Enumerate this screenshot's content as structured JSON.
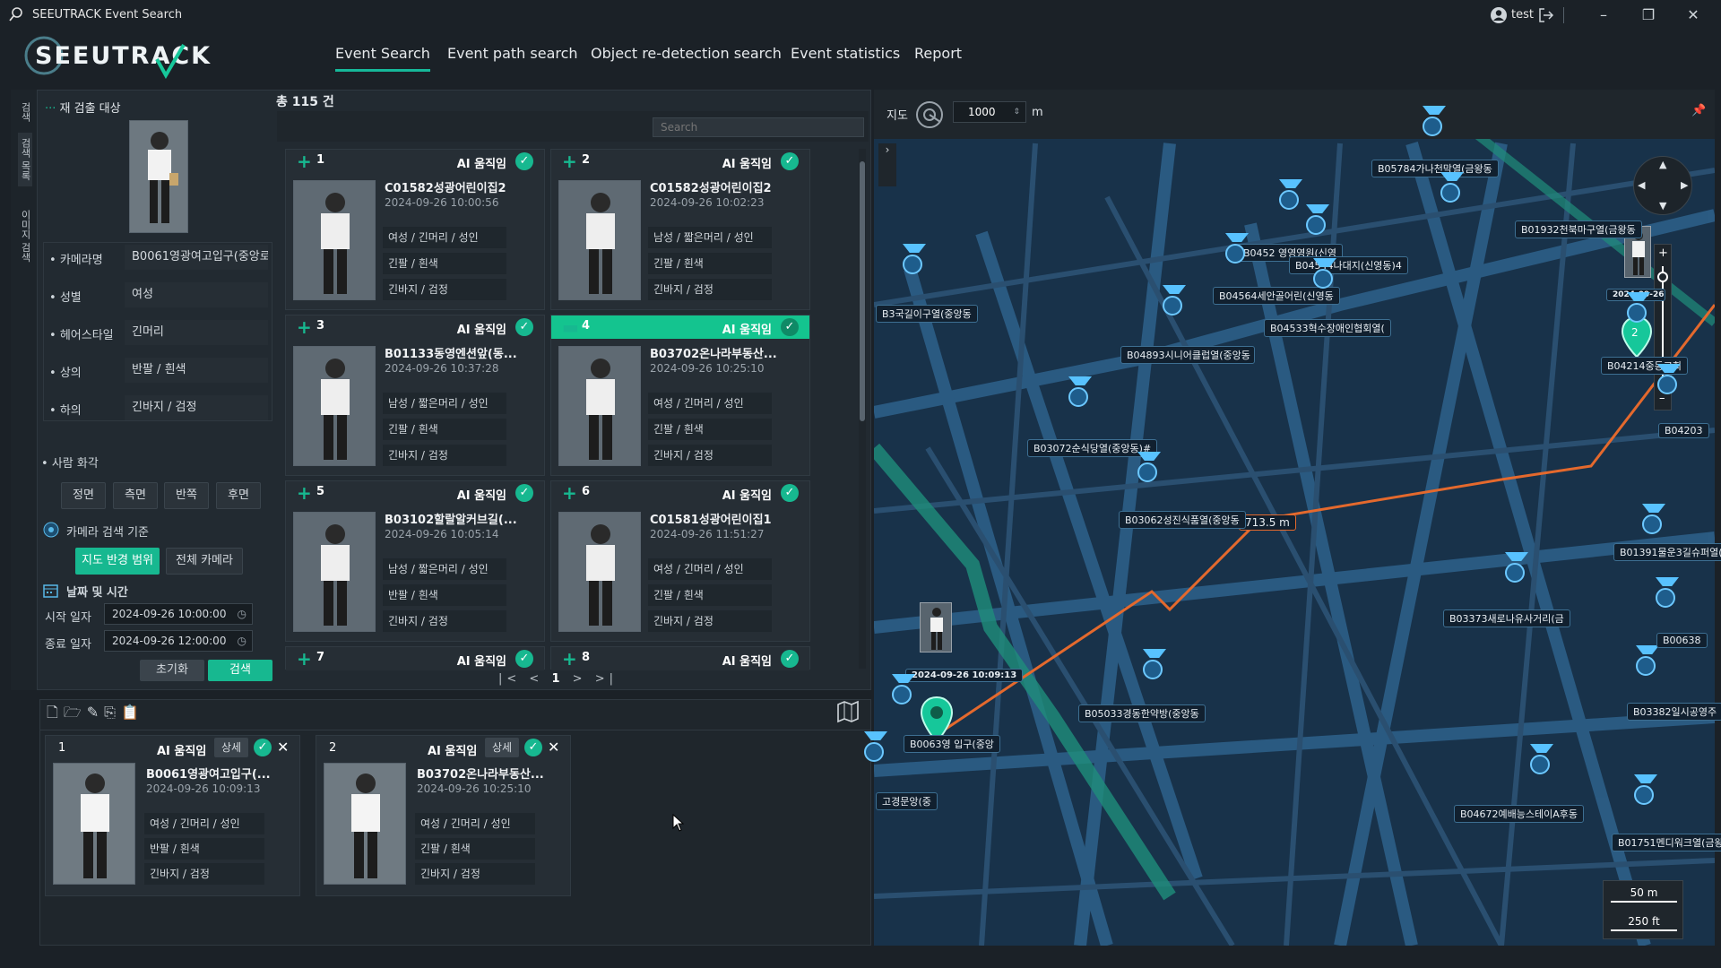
{
  "window": {
    "title": "SEEUTRACK Event Search",
    "user": "test"
  },
  "logo": "SEEUTRACK",
  "nav": [
    "Event Search",
    "Event path search",
    "Object re-detection search",
    "Event statistics",
    "Report"
  ],
  "side_tabs": [
    "검색",
    "검색 목록",
    "이미지 검색"
  ],
  "query": {
    "title": "재 검출 대상",
    "fields": [
      {
        "label": "카메라명",
        "value": "B0061영광여고입구(중앙로"
      },
      {
        "label": "성별",
        "value": "여성"
      },
      {
        "label": "헤어스타일",
        "value": "긴머리"
      },
      {
        "label": "상의",
        "value": "반팔  /  흰색"
      },
      {
        "label": "하의",
        "value": "긴바지  /  검정"
      }
    ],
    "pose_title": "사람 화각",
    "poses": [
      "정면",
      "측면",
      "반쪽",
      "후면"
    ],
    "camera_criteria_title": "카메라 검색 기준",
    "camera_criteria": [
      "지도 반경 범위",
      "전체 카메라"
    ],
    "datetime_title": "날짜 및 시간",
    "start_label": "시작 일자",
    "start_value": "2024-09-26 10:00:00",
    "end_label": "종료 일자",
    "end_value": "2024-09-26 12:00:00",
    "reset_label": "초기화",
    "search_label": "검색"
  },
  "results": {
    "total": "총 115 건",
    "search_placeholder": "Search",
    "cards": [
      {
        "num": "1",
        "ai": "AI 움직임",
        "name": "C01582성광어린이집2",
        "time": "2024-09-26 10:00:56",
        "attrs": [
          "여성 / 긴머리 / 성인",
          "긴팔 / 흰색",
          "긴바지 / 검정"
        ]
      },
      {
        "num": "2",
        "ai": "AI 움직임",
        "name": "C01582성광어린이집2",
        "time": "2024-09-26 10:02:23",
        "attrs": [
          "남성 / 짧은머리 / 성인",
          "긴팔 / 흰색",
          "긴바지 / 검정"
        ]
      },
      {
        "num": "3",
        "ai": "AI 움직임",
        "name": "B01133동영엔션앞(동...",
        "time": "2024-09-26 10:37:28",
        "attrs": [
          "남성 / 짧은머리 / 성인",
          "긴팔 / 흰색",
          "긴바지 / 검정"
        ]
      },
      {
        "num": "4",
        "ai": "AI 움직임",
        "name": "B03702온나라부동산...",
        "time": "2024-09-26 10:25:10",
        "attrs": [
          "여성 / 긴머리 / 성인",
          "긴팔 / 흰색",
          "긴바지 / 검정"
        ]
      },
      {
        "num": "5",
        "ai": "AI 움직임",
        "name": "B03102할랄알커브길(...",
        "time": "2024-09-26 10:05:14",
        "attrs": [
          "남성 / 짧은머리 / 성인",
          "반팔 / 흰색",
          "긴바지 / 검정"
        ]
      },
      {
        "num": "6",
        "ai": "AI 움직임",
        "name": "C01581성광어린이집1",
        "time": "2024-09-26 11:51:27",
        "attrs": [
          "여성 / 긴머리 / 성인",
          "긴팔 / 흰색",
          "긴바지 / 검정"
        ]
      },
      {
        "num": "7",
        "ai": "AI 움직임"
      },
      {
        "num": "8",
        "ai": "AI 움직임"
      }
    ],
    "page": "1"
  },
  "selected": {
    "cards": [
      {
        "num": "1",
        "ai": "AI 움직임",
        "detail": "상세",
        "name": "B0061영광여고입구(...",
        "time": "2024-09-26 10:09:13",
        "attrs": [
          "여성 / 긴머리 / 성인",
          "반팔 / 흰색",
          "긴바지 / 검정"
        ]
      },
      {
        "num": "2",
        "ai": "AI 움직임",
        "detail": "상세",
        "name": "B03702온나라부동산...",
        "time": "2024-09-26 10:25:10",
        "attrs": [
          "여성 / 긴머리 / 성인",
          "긴팔 / 흰색",
          "긴바지 / 검정"
        ]
      }
    ]
  },
  "map": {
    "label": "지도",
    "radius": "1000",
    "unit": "m",
    "distance": "713.5 m",
    "scale_m": "50 m",
    "scale_ft": "250 ft",
    "timestamp_start": "2024-09-26 10:09:13",
    "timestamp_end": "2024-09-26 10:25:10",
    "cameras": [
      "B05784가나천막열(금왕동",
      "B0452 영영영원(신영",
      "B04544나대지(신영동)4",
      "B01932천북마구열(금왕동",
      "B04564세안골어린(신영동",
      "B04533혁수장애인협회열(",
      "B04893시니어클럽열(중앙동",
      "B03072순식당열(중앙동)#",
      "B03062성진식품열(중앙동",
      "B04214중동교회",
      "B01391물운3길슈퍼열(",
      "B03373새로나유사거리(금",
      "B05033경동한약방(중앙동",
      "B04672예배능스테이A후동",
      "B03382일시공영주",
      "B01751멘디워크열(금왕",
      "B00638",
      "B04203",
      "B0063영 입구(중앙",
      "고경문앙(중",
      "B3국길이구열(중앙동"
    ]
  }
}
